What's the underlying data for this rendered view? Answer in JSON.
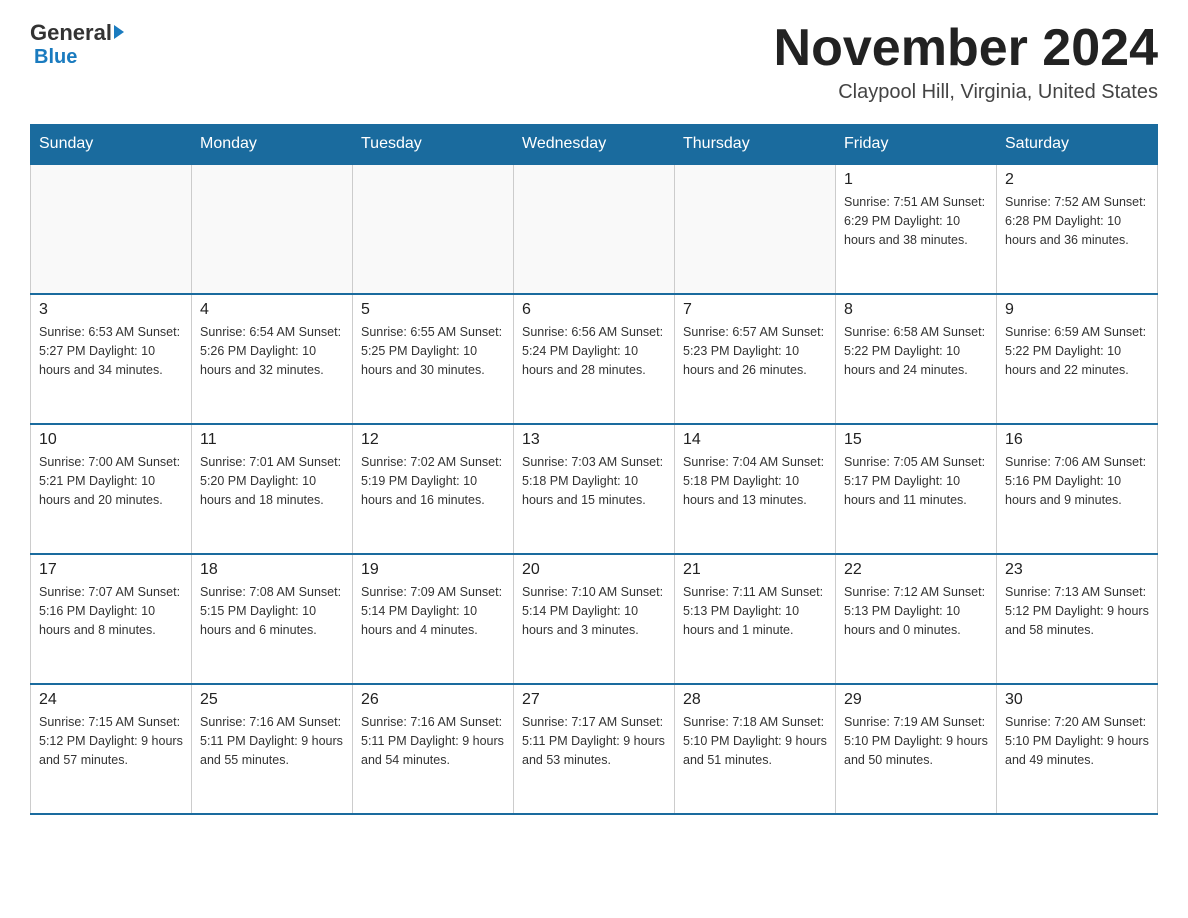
{
  "logo": {
    "general": "General",
    "blue": "Blue",
    "arrow": "►"
  },
  "title": "November 2024",
  "subtitle": "Claypool Hill, Virginia, United States",
  "days_of_week": [
    "Sunday",
    "Monday",
    "Tuesday",
    "Wednesday",
    "Thursday",
    "Friday",
    "Saturday"
  ],
  "weeks": [
    [
      {
        "day": "",
        "info": ""
      },
      {
        "day": "",
        "info": ""
      },
      {
        "day": "",
        "info": ""
      },
      {
        "day": "",
        "info": ""
      },
      {
        "day": "",
        "info": ""
      },
      {
        "day": "1",
        "info": "Sunrise: 7:51 AM\nSunset: 6:29 PM\nDaylight: 10 hours and 38 minutes."
      },
      {
        "day": "2",
        "info": "Sunrise: 7:52 AM\nSunset: 6:28 PM\nDaylight: 10 hours and 36 minutes."
      }
    ],
    [
      {
        "day": "3",
        "info": "Sunrise: 6:53 AM\nSunset: 5:27 PM\nDaylight: 10 hours and 34 minutes."
      },
      {
        "day": "4",
        "info": "Sunrise: 6:54 AM\nSunset: 5:26 PM\nDaylight: 10 hours and 32 minutes."
      },
      {
        "day": "5",
        "info": "Sunrise: 6:55 AM\nSunset: 5:25 PM\nDaylight: 10 hours and 30 minutes."
      },
      {
        "day": "6",
        "info": "Sunrise: 6:56 AM\nSunset: 5:24 PM\nDaylight: 10 hours and 28 minutes."
      },
      {
        "day": "7",
        "info": "Sunrise: 6:57 AM\nSunset: 5:23 PM\nDaylight: 10 hours and 26 minutes."
      },
      {
        "day": "8",
        "info": "Sunrise: 6:58 AM\nSunset: 5:22 PM\nDaylight: 10 hours and 24 minutes."
      },
      {
        "day": "9",
        "info": "Sunrise: 6:59 AM\nSunset: 5:22 PM\nDaylight: 10 hours and 22 minutes."
      }
    ],
    [
      {
        "day": "10",
        "info": "Sunrise: 7:00 AM\nSunset: 5:21 PM\nDaylight: 10 hours and 20 minutes."
      },
      {
        "day": "11",
        "info": "Sunrise: 7:01 AM\nSunset: 5:20 PM\nDaylight: 10 hours and 18 minutes."
      },
      {
        "day": "12",
        "info": "Sunrise: 7:02 AM\nSunset: 5:19 PM\nDaylight: 10 hours and 16 minutes."
      },
      {
        "day": "13",
        "info": "Sunrise: 7:03 AM\nSunset: 5:18 PM\nDaylight: 10 hours and 15 minutes."
      },
      {
        "day": "14",
        "info": "Sunrise: 7:04 AM\nSunset: 5:18 PM\nDaylight: 10 hours and 13 minutes."
      },
      {
        "day": "15",
        "info": "Sunrise: 7:05 AM\nSunset: 5:17 PM\nDaylight: 10 hours and 11 minutes."
      },
      {
        "day": "16",
        "info": "Sunrise: 7:06 AM\nSunset: 5:16 PM\nDaylight: 10 hours and 9 minutes."
      }
    ],
    [
      {
        "day": "17",
        "info": "Sunrise: 7:07 AM\nSunset: 5:16 PM\nDaylight: 10 hours and 8 minutes."
      },
      {
        "day": "18",
        "info": "Sunrise: 7:08 AM\nSunset: 5:15 PM\nDaylight: 10 hours and 6 minutes."
      },
      {
        "day": "19",
        "info": "Sunrise: 7:09 AM\nSunset: 5:14 PM\nDaylight: 10 hours and 4 minutes."
      },
      {
        "day": "20",
        "info": "Sunrise: 7:10 AM\nSunset: 5:14 PM\nDaylight: 10 hours and 3 minutes."
      },
      {
        "day": "21",
        "info": "Sunrise: 7:11 AM\nSunset: 5:13 PM\nDaylight: 10 hours and 1 minute."
      },
      {
        "day": "22",
        "info": "Sunrise: 7:12 AM\nSunset: 5:13 PM\nDaylight: 10 hours and 0 minutes."
      },
      {
        "day": "23",
        "info": "Sunrise: 7:13 AM\nSunset: 5:12 PM\nDaylight: 9 hours and 58 minutes."
      }
    ],
    [
      {
        "day": "24",
        "info": "Sunrise: 7:15 AM\nSunset: 5:12 PM\nDaylight: 9 hours and 57 minutes."
      },
      {
        "day": "25",
        "info": "Sunrise: 7:16 AM\nSunset: 5:11 PM\nDaylight: 9 hours and 55 minutes."
      },
      {
        "day": "26",
        "info": "Sunrise: 7:16 AM\nSunset: 5:11 PM\nDaylight: 9 hours and 54 minutes."
      },
      {
        "day": "27",
        "info": "Sunrise: 7:17 AM\nSunset: 5:11 PM\nDaylight: 9 hours and 53 minutes."
      },
      {
        "day": "28",
        "info": "Sunrise: 7:18 AM\nSunset: 5:10 PM\nDaylight: 9 hours and 51 minutes."
      },
      {
        "day": "29",
        "info": "Sunrise: 7:19 AM\nSunset: 5:10 PM\nDaylight: 9 hours and 50 minutes."
      },
      {
        "day": "30",
        "info": "Sunrise: 7:20 AM\nSunset: 5:10 PM\nDaylight: 9 hours and 49 minutes."
      }
    ]
  ]
}
